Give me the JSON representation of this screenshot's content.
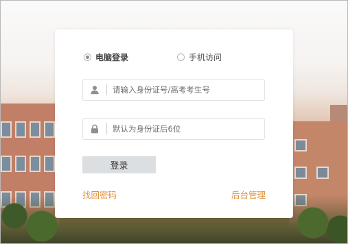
{
  "login_mode": {
    "options": [
      {
        "label": "电脑登录",
        "selected": true
      },
      {
        "label": "手机访问",
        "selected": false
      }
    ]
  },
  "form": {
    "id_placeholder": "请输入身份证号/高考考生号",
    "password_placeholder": "默认为身份证后6位",
    "login_button": "登录"
  },
  "links": {
    "forgot_password": "找回密码",
    "admin": "后台管理"
  },
  "colors": {
    "link": "#e2923d",
    "button_bg": "#dcdfe2"
  },
  "icons": [
    "user-icon",
    "lock-icon"
  ]
}
